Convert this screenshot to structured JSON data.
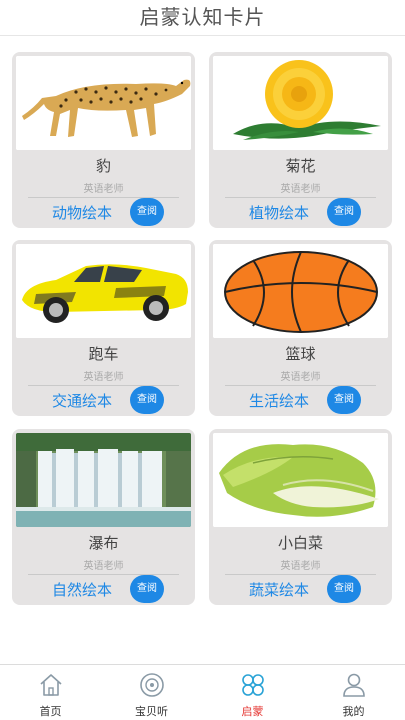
{
  "header": {
    "title": "启蒙认知卡片"
  },
  "cards": [
    {
      "name": "豹",
      "teacher": "英语老师",
      "category": "动物绘本",
      "button": "查阅",
      "image": "cheetah"
    },
    {
      "name": "菊花",
      "teacher": "英语老师",
      "category": "植物绘本",
      "button": "查阅",
      "image": "chrysanthemum"
    },
    {
      "name": "跑车",
      "teacher": "英语老师",
      "category": "交通绘本",
      "button": "查阅",
      "image": "sports-car"
    },
    {
      "name": "篮球",
      "teacher": "英语老师",
      "category": "生活绘本",
      "button": "查阅",
      "image": "basketball"
    },
    {
      "name": "瀑布",
      "teacher": "英语老师",
      "category": "自然绘本",
      "button": "查阅",
      "image": "waterfall"
    },
    {
      "name": "小白菜",
      "teacher": "英语老师",
      "category": "蔬菜绘本",
      "button": "查阅",
      "image": "bok-choy"
    }
  ],
  "tabbar": {
    "items": [
      {
        "label": "首页",
        "icon": "home-icon",
        "active": false
      },
      {
        "label": "宝贝听",
        "icon": "disc-icon",
        "active": false
      },
      {
        "label": "启蒙",
        "icon": "clover-icon",
        "active": true
      },
      {
        "label": "我的",
        "icon": "user-icon",
        "active": false
      }
    ]
  },
  "colors": {
    "accent": "#1e88e5",
    "active_tab": "#e53935",
    "card_bg": "#e5e3e3"
  }
}
